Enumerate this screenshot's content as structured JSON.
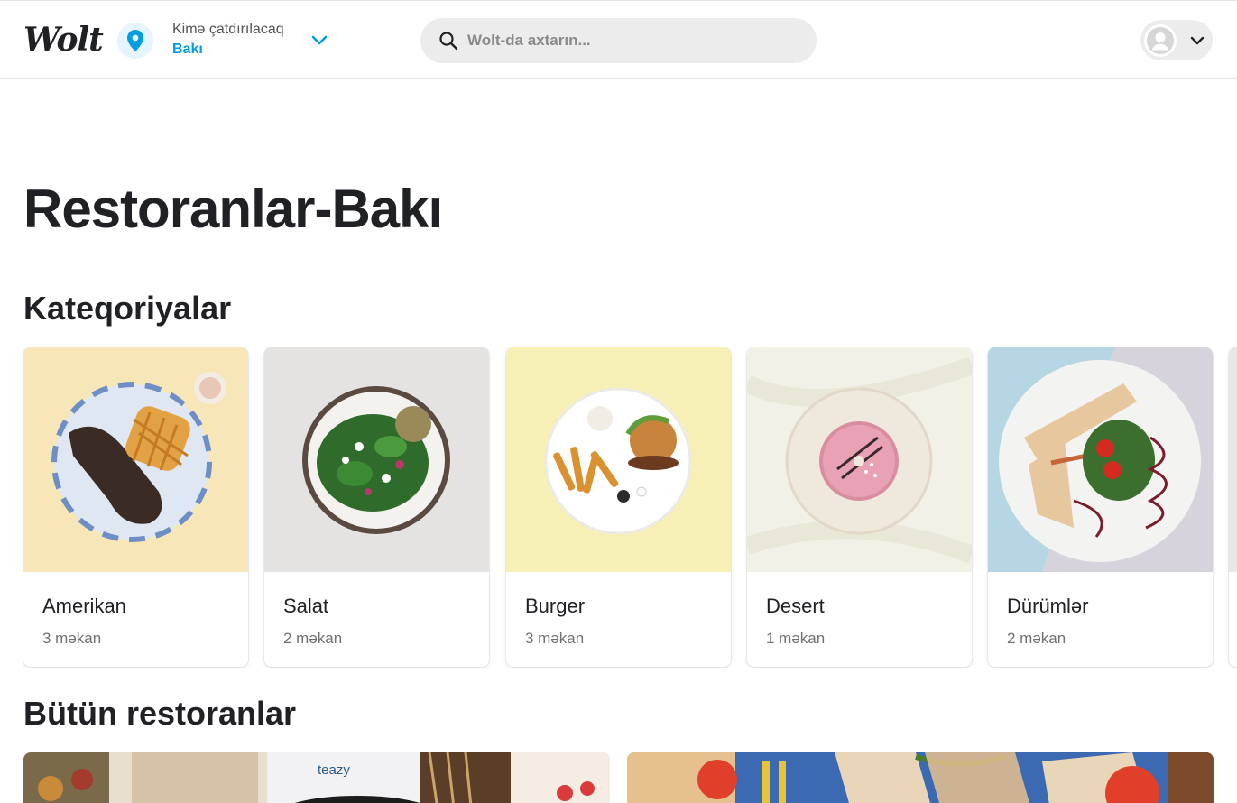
{
  "header": {
    "logo": "Wolt",
    "location_label": "Kimə çatdırılacaq",
    "location_city": "Bakı",
    "search_placeholder": "Wolt-da axtarın..."
  },
  "page_title": "Restoranlar-Bakı",
  "categories_title": "Kateqoriyalar",
  "categories": [
    {
      "name": "Amerikan",
      "count": "3 məkan"
    },
    {
      "name": "Salat",
      "count": "2 məkan"
    },
    {
      "name": "Burger",
      "count": "3 məkan"
    },
    {
      "name": "Desert",
      "count": "1 məkan"
    },
    {
      "name": "Dürümlər",
      "count": "2 məkan"
    }
  ],
  "all_restaurants_title": "Bütün restoranlar",
  "restaurant_card_text": "teazy",
  "colors": {
    "brand": "#009de0",
    "text": "#202125",
    "muted": "#707070",
    "search_bg": "#ececec"
  },
  "icons": [
    "location-pin-icon",
    "chevron-down-icon",
    "search-icon",
    "user-avatar-icon"
  ]
}
